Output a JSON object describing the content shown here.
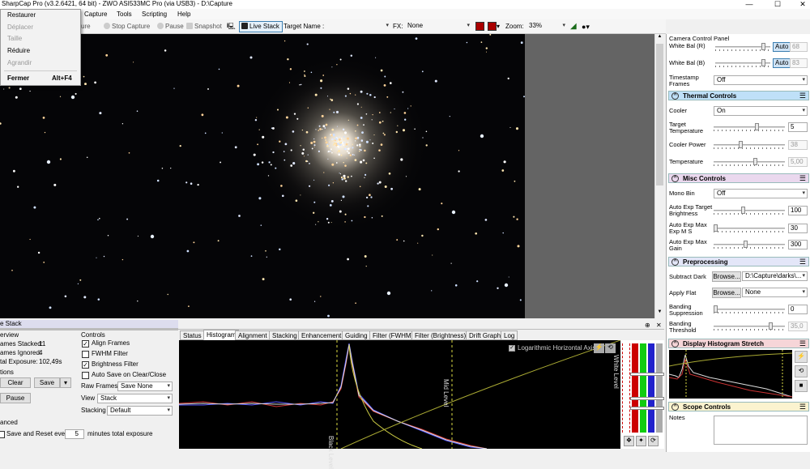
{
  "window": {
    "title": "SharpCap Pro (v3.2.6421, 64 bit) - ZWO ASI533MC Pro (via USB3) - D:\\Capture",
    "minimize": "—",
    "maximize": "☐",
    "close": "✕"
  },
  "menubar": {
    "capture": "Capture",
    "tools": "Tools",
    "scripting": "Scripting",
    "help": "Help"
  },
  "system_menu": {
    "items": [
      {
        "label": "Restaurer",
        "enabled": true
      },
      {
        "label": "Déplacer",
        "enabled": false
      },
      {
        "label": "Taille",
        "enabled": false
      },
      {
        "label": "Réduire",
        "enabled": true
      },
      {
        "label": "Agrandir",
        "enabled": false
      }
    ],
    "close_label": "Fermer",
    "close_shortcut": "Alt+F4"
  },
  "toolbar": {
    "partial_capture": "ure",
    "stop_capture": "Stop Capture",
    "pause": "Pause",
    "snapshot": "Snapshot",
    "live_stack": "Live Stack",
    "target_name_label": "Target Name :",
    "fx_label": "FX:",
    "fx_value": "None",
    "zoom_label": "Zoom:",
    "zoom_value": "33%"
  },
  "camera_panel": {
    "title": "Camera Control Panel",
    "white_bal_r": {
      "label": "White Bal (R)",
      "auto": "Auto",
      "value": "68",
      "level": 0.92
    },
    "white_bal_b": {
      "label": "White Bal (B)",
      "auto": "Auto",
      "value": "83",
      "level": 0.92
    },
    "timestamp": {
      "label": "Timestamp Frames",
      "value": "Off"
    },
    "thermal": {
      "title": "Thermal Controls",
      "cooler_label": "Cooler",
      "cooler_value": "On",
      "target_temp_label": "Target Temperature",
      "target_temp_value": "5",
      "target_temp_level": 0.62,
      "cooler_power_label": "Cooler Power",
      "cooler_power_value": "38",
      "cooler_power_level": 0.38,
      "temperature_label": "Temperature",
      "temperature_value": "5,00",
      "temperature_level": 0.6
    },
    "misc": {
      "title": "Misc Controls",
      "mono_bin_label": "Mono Bin",
      "mono_bin_value": "Off",
      "auto_exp_target_label": "Auto Exp Target Brightness",
      "auto_exp_target_value": "100",
      "auto_exp_target_level": 0.42,
      "auto_exp_max_ms_label": "Auto Exp Max Exp M S",
      "auto_exp_max_ms_value": "30",
      "auto_exp_max_ms_level": 0.0,
      "auto_exp_max_gain_label": "Auto Exp Max Gain",
      "auto_exp_max_gain_value": "300",
      "auto_exp_max_gain_level": 0.45
    },
    "preprocessing": {
      "title": "Preprocessing",
      "subtract_dark_label": "Subtract Dark",
      "browse1": "Browse...",
      "subtract_dark_value": "D:\\Capture\\darks\\...",
      "apply_flat_label": "Apply Flat",
      "browse2": "Browse...",
      "apply_flat_value": "None",
      "banding_supp_label": "Banding Suppression",
      "banding_supp_value": "0",
      "banding_supp_level": 0.0,
      "banding_thresh_label": "Banding Threshold",
      "banding_thresh_value": "35,0",
      "banding_thresh_level": 0.83
    },
    "display_histogram": {
      "title": "Display Histogram Stretch"
    },
    "scope": {
      "title": "Scope Controls",
      "notes_label": "Notes"
    }
  },
  "live_stack": {
    "header": "e Stack",
    "overview_label": "erview",
    "frames_stacked_label": "ames Stacked:",
    "frames_stacked": "11",
    "frames_ignored_label": "ames Ignored:",
    "frames_ignored": "4",
    "total_exposure_label": "tal Exposure:",
    "total_exposure": "102,49s",
    "options_label": "tions",
    "clear": "Clear",
    "save": "Save",
    "pause": "Pause",
    "controls_label": "Controls",
    "align_frames": "Align Frames",
    "fwhm_filter": "FWHM Filter",
    "brightness_filter": "Brightness Filter",
    "auto_save": "Auto Save on Clear/Close",
    "raw_frames_label": "Raw Frames",
    "raw_frames_value": "Save None",
    "view_label": "View",
    "view_value": "Stack",
    "stacking_label": "Stacking",
    "stacking_value": "Default",
    "advanced_label": "anced",
    "save_reset_label": "Save and Reset every",
    "save_reset_value": "5",
    "save_reset_suffix": "minutes total exposure",
    "pin": "⊕",
    "close": "✕"
  },
  "tabs": [
    "Status",
    "Histogram",
    "Alignment",
    "Stacking",
    "Enhancement",
    "Guiding",
    "Filter (FWHM)",
    "Filter (Brightness)",
    "Drift Graph",
    "Log"
  ],
  "histogram": {
    "log_axis_label": "Logarithmic Horizontal Axis",
    "black_level": "Black Level",
    "mid_level": "Mid Level",
    "white_level": "White Level"
  },
  "colors": {
    "thermal": "#bfe0f8",
    "misc": "#ead8ee",
    "preprocessing": "#e3e6f8",
    "display": "#f6d5d8",
    "scope": "#fbf3cf"
  }
}
